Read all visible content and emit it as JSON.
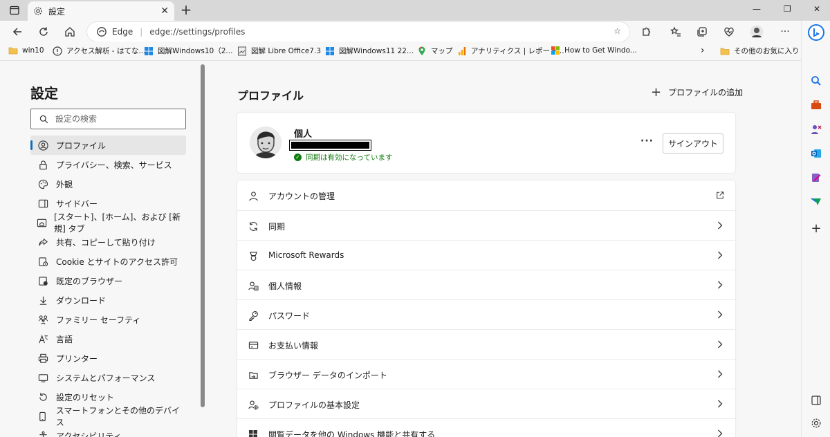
{
  "tab": {
    "title": "設定"
  },
  "omnibox": {
    "site_label": "Edge",
    "url": "edge://settings/profiles"
  },
  "bookmarks": [
    {
      "label": "win10"
    },
    {
      "label": "アクセス解析 - はてな..."
    },
    {
      "label": "図解Windows10（2..."
    },
    {
      "label": "図解 Libre Office7.3"
    },
    {
      "label": "図解Windows11 22..."
    },
    {
      "label": "マップ"
    },
    {
      "label": "アナリティクス | レポート..."
    },
    {
      "label": "How to Get Windo..."
    },
    {
      "label": "その他のお気に入り"
    }
  ],
  "settings": {
    "title": "設定",
    "search_placeholder": "設定の検索",
    "nav": [
      {
        "label": "プロファイル",
        "icon": "profile-icon"
      },
      {
        "label": "プライバシー、検索、サービス",
        "icon": "lock-icon"
      },
      {
        "label": "外観",
        "icon": "appearance-icon"
      },
      {
        "label": "サイドバー",
        "icon": "sidebar-icon"
      },
      {
        "label": "[スタート]、[ホーム]、および [新規] タブ",
        "icon": "home-tabs-icon"
      },
      {
        "label": "共有、コピーして貼り付け",
        "icon": "share-icon"
      },
      {
        "label": "Cookie とサイトのアクセス許可",
        "icon": "cookie-icon"
      },
      {
        "label": "既定のブラウザー",
        "icon": "default-browser-icon"
      },
      {
        "label": "ダウンロード",
        "icon": "download-icon"
      },
      {
        "label": "ファミリー セーフティ",
        "icon": "family-icon"
      },
      {
        "label": "言語",
        "icon": "language-icon"
      },
      {
        "label": "プリンター",
        "icon": "printer-icon"
      },
      {
        "label": "システムとパフォーマンス",
        "icon": "system-icon"
      },
      {
        "label": "設定のリセット",
        "icon": "reset-icon"
      },
      {
        "label": "スマートフォンとその他のデバイス",
        "icon": "phone-icon"
      },
      {
        "label": "アクセシビリティ",
        "icon": "accessibility-icon"
      }
    ]
  },
  "main": {
    "title": "プロファイル",
    "add_profile": "プロファイルの追加",
    "profile": {
      "name": "個人",
      "sync_status": "同期は有効になっています",
      "more": "···",
      "signout": "サインアウト"
    },
    "rows": [
      {
        "label": "アカウントの管理",
        "icon": "account-icon",
        "action": "external"
      },
      {
        "label": "同期",
        "icon": "sync-icon",
        "action": "chevron"
      },
      {
        "label": "Microsoft Rewards",
        "icon": "rewards-icon",
        "action": "chevron"
      },
      {
        "label": "個人情報",
        "icon": "personal-info-icon",
        "action": "chevron"
      },
      {
        "label": "パスワード",
        "icon": "key-icon",
        "action": "chevron"
      },
      {
        "label": "お支払い情報",
        "icon": "card-icon",
        "action": "chevron"
      },
      {
        "label": "ブラウザー データのインポート",
        "icon": "import-icon",
        "action": "chevron"
      },
      {
        "label": "プロファイルの基本設定",
        "icon": "profile-settings-icon",
        "action": "chevron"
      },
      {
        "label": "閲覧データを他の Windows 機能と共有する",
        "icon": "windows-icon",
        "action": "chevron"
      }
    ]
  },
  "colors": {
    "accent": "#0f6cbd",
    "sync_ok": "#107c10"
  }
}
